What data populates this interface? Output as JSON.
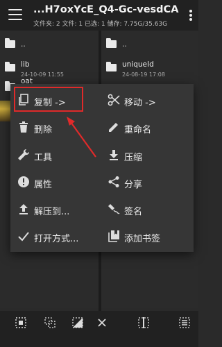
{
  "header": {
    "title": "...H7oxYcE_Q4-Gc-vesdCA==/",
    "subtitle": "文件夹: 2  文件: 1  已选: 1  储存: 7.75G/35.63G",
    "menu_icon": "hamburger-icon",
    "more_icon": "more-vertical-icon"
  },
  "left_pane": {
    "items": [
      {
        "name": "..",
        "date": ""
      },
      {
        "name": "lib",
        "date": "24-10-09 11:55"
      },
      {
        "name": "oat",
        "date": ""
      }
    ]
  },
  "right_pane": {
    "items": [
      {
        "name": "..",
        "date": ""
      },
      {
        "name": "uniqueId",
        "date": "24-08-19 17:08"
      }
    ]
  },
  "context_menu": {
    "left": [
      {
        "label": "复制 ->",
        "icon": "copy-icon"
      },
      {
        "label": "删除",
        "icon": "trash-icon"
      },
      {
        "label": "工具",
        "icon": "wrench-icon"
      },
      {
        "label": "属性",
        "icon": "info-icon"
      },
      {
        "label": "解压到...",
        "icon": "upload-icon"
      },
      {
        "label": "打开方式...",
        "icon": "check-icon"
      }
    ],
    "right": [
      {
        "label": "移动 ->",
        "icon": "scissors-icon"
      },
      {
        "label": "重命名",
        "icon": "pencil-icon"
      },
      {
        "label": "压缩",
        "icon": "download-icon"
      },
      {
        "label": "分享",
        "icon": "share-icon"
      },
      {
        "label": "签名",
        "icon": "signature-icon"
      },
      {
        "label": "添加书签",
        "icon": "bookmarks-icon"
      }
    ]
  },
  "annotation": {
    "highlight_color": "#e02a2a"
  },
  "bottom_bar": {
    "icons": [
      "select-all-icon",
      "select-range-icon",
      "select-inverse-icon",
      "close-icon",
      "split-pane-icon",
      "grid-select-icon"
    ]
  },
  "colors": {
    "background": "#2a2a2a",
    "toolbar": "#212121",
    "menu": "#363636",
    "text": "#ececec"
  }
}
